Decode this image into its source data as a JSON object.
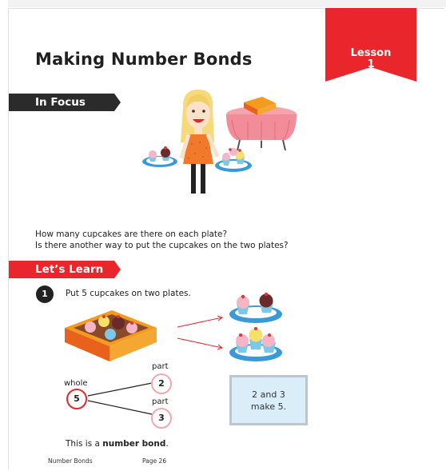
{
  "header": {
    "title": "Making Number Bonds",
    "lesson_line1": "Lesson",
    "lesson_line2": "1"
  },
  "in_focus": {
    "banner": "In Focus",
    "question1": "How many cupcakes are there on each plate?",
    "question2": "Is there another way to put the cupcakes on the two plates?"
  },
  "lets_learn": {
    "banner": "Let’s Learn",
    "step_number": "1",
    "step_text": "Put 5 cupcakes on two plates.",
    "bond": {
      "whole_label": "whole",
      "whole_value": "5",
      "part_label_top": "part",
      "part_value_top": "2",
      "part_label_bottom": "part",
      "part_value_bottom": "3"
    },
    "note_line1": "2 and 3",
    "note_line2": "make 5.",
    "caption_prefix": "This is a ",
    "caption_bold": "number bond",
    "caption_suffix": "."
  },
  "footer": {
    "left": "Number Bonds",
    "page": "Page 26"
  },
  "colors": {
    "accent_red": "#e8262b",
    "banner_dark": "#2b2b2b",
    "note_bg": "#d9eef8"
  }
}
